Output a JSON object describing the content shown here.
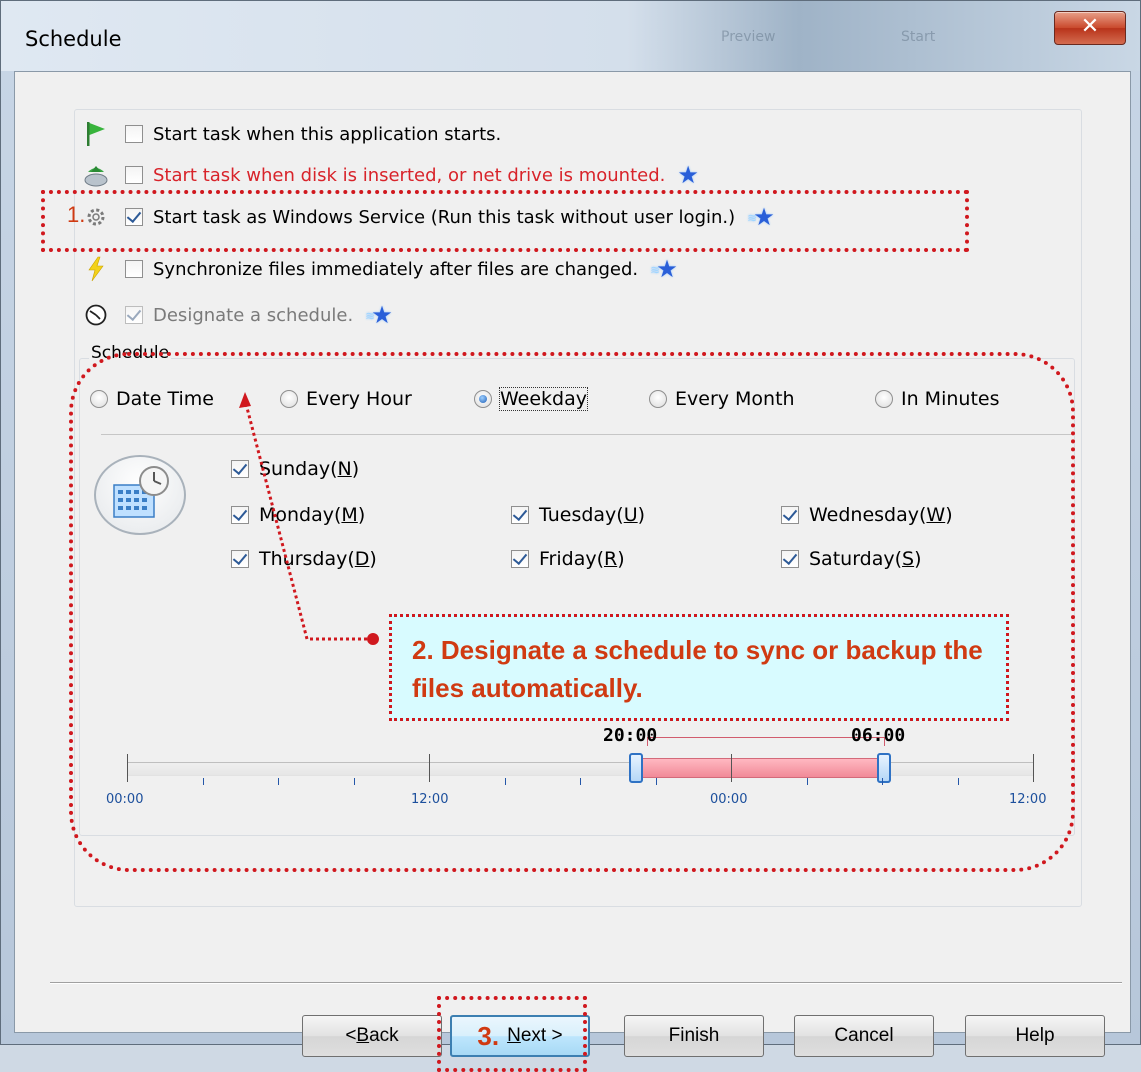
{
  "window": {
    "title": "Schedule",
    "close_glyph": "✕",
    "bg_ghost": [
      "Preview",
      "Start"
    ]
  },
  "options": [
    {
      "icon": "green-flag-icon",
      "label": "Start task when this application starts.",
      "checked": false,
      "style": "normal"
    },
    {
      "icon": "disk-insert-icon",
      "label": "Start task when disk is inserted, or net drive is mounted.",
      "checked": false,
      "style": "red"
    },
    {
      "icon": "gear-icon",
      "label": "Start task as Windows Service (Run this task without user login.)",
      "checked": true,
      "style": "normal"
    },
    {
      "icon": "lightning-icon",
      "label": "Synchronize files immediately after files are changed.",
      "checked": false,
      "style": "normal"
    },
    {
      "icon": "clock-icon",
      "label": "Designate a schedule.",
      "checked": true,
      "style": "disabled"
    }
  ],
  "schedule": {
    "group_label": "Schedule",
    "modes": [
      "Date Time",
      "Every Hour",
      "Weekday",
      "Every Month",
      "In Minutes"
    ],
    "selected_mode": "Weekday",
    "days": [
      {
        "label": "Sunday(",
        "key": "N",
        "tail": ")",
        "checked": true
      },
      {
        "label": "Monday(",
        "key": "M",
        "tail": ")",
        "checked": true
      },
      {
        "label": "Tuesday(",
        "key": "U",
        "tail": ")",
        "checked": true
      },
      {
        "label": "Wednesday(",
        "key": "W",
        "tail": ")",
        "checked": true
      },
      {
        "label": "Thursday(",
        "key": "D",
        "tail": ")",
        "checked": true
      },
      {
        "label": "Friday(",
        "key": "R",
        "tail": ")",
        "checked": true
      },
      {
        "label": "Saturday(",
        "key": "S",
        "tail": ")",
        "checked": true
      }
    ],
    "timeline": {
      "tick_labels": [
        "00:00",
        "12:00",
        "00:00",
        "12:00"
      ],
      "start_time": "20:00",
      "end_time": "06:00"
    }
  },
  "annotations": {
    "step1": "1.",
    "step2": "2. Designate a schedule to sync or backup the files automatically.",
    "step3": "3."
  },
  "buttons": {
    "back": {
      "pre": "< ",
      "key": "B",
      "post": "ack"
    },
    "next": {
      "pre": "",
      "key": "N",
      "post": "ext >"
    },
    "finish": "Finish",
    "cancel": "Cancel",
    "help": "Help"
  },
  "colors": {
    "annotation_red": "#d0181e",
    "annotation_text": "#d03a12",
    "annotation_bg": "#d8fbff",
    "range_fill": "#f18a98",
    "red_option": "#d8232a"
  }
}
